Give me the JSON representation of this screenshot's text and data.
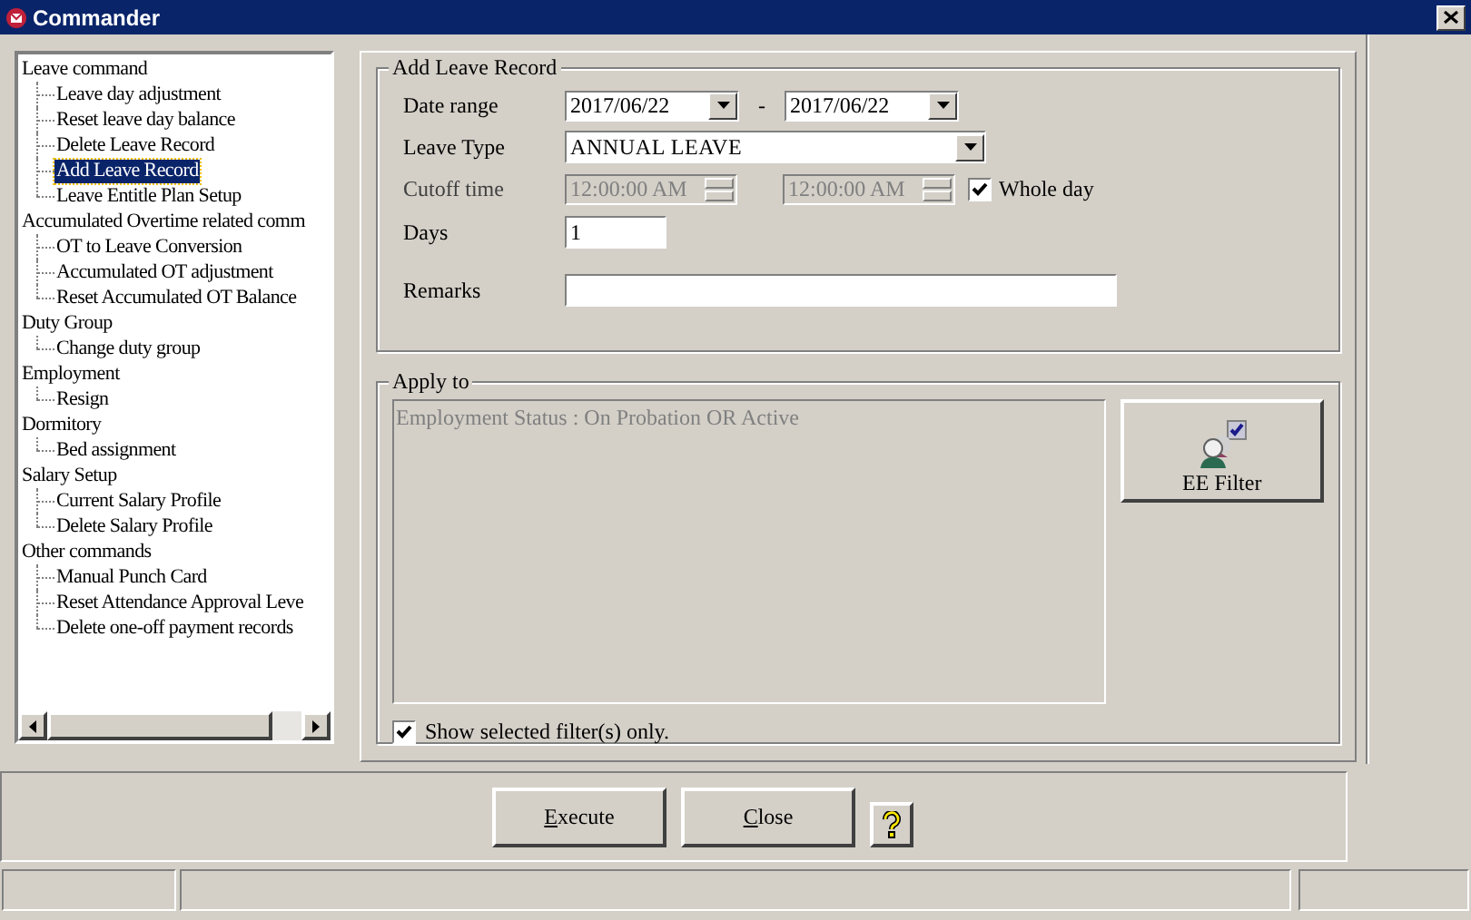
{
  "window": {
    "title": "Commander"
  },
  "tree": [
    {
      "label": "Leave command",
      "selected": false,
      "children": [
        {
          "label": "Leave day adjustment",
          "selected": false
        },
        {
          "label": "Reset leave day balance",
          "selected": false
        },
        {
          "label": "Delete Leave Record",
          "selected": false
        },
        {
          "label": "Add Leave Record",
          "selected": true
        },
        {
          "label": "Leave Entitle Plan Setup",
          "selected": false
        }
      ]
    },
    {
      "label": "Accumulated Overtime related comm",
      "selected": false,
      "children": [
        {
          "label": "OT to Leave Conversion",
          "selected": false
        },
        {
          "label": "Accumulated OT adjustment",
          "selected": false
        },
        {
          "label": "Reset Accumulated OT Balance",
          "selected": false
        }
      ]
    },
    {
      "label": "Duty Group",
      "selected": false,
      "children": [
        {
          "label": "Change duty group",
          "selected": false
        }
      ]
    },
    {
      "label": "Employment",
      "selected": false,
      "children": [
        {
          "label": "Resign",
          "selected": false
        }
      ]
    },
    {
      "label": "Dormitory",
      "selected": false,
      "children": [
        {
          "label": "Bed assignment",
          "selected": false
        }
      ]
    },
    {
      "label": "Salary Setup",
      "selected": false,
      "children": [
        {
          "label": "Current Salary Profile",
          "selected": false
        },
        {
          "label": "Delete Salary Profile",
          "selected": false
        }
      ]
    },
    {
      "label": "Other commands",
      "selected": false,
      "children": [
        {
          "label": "Manual Punch Card",
          "selected": false
        },
        {
          "label": "Reset Attendance Approval Leve",
          "selected": false
        },
        {
          "label": "Delete one-off payment records",
          "selected": false
        }
      ]
    }
  ],
  "leave_record": {
    "title": "Add Leave Record",
    "date_range": {
      "label": "Date range",
      "from": "2017/06/22",
      "separator": "-",
      "to": "2017/06/22"
    },
    "leave_type": {
      "label": "Leave Type",
      "value": "ANNUAL LEAVE"
    },
    "cutoff": {
      "label": "Cutoff time",
      "from": "12:00:00 AM",
      "to": "12:00:00 AM",
      "disabled": true
    },
    "whole_day": {
      "label": "Whole day",
      "checked": true
    },
    "days": {
      "label": "Days",
      "value": "1"
    },
    "remarks": {
      "label": "Remarks"
    }
  },
  "apply_to": {
    "title": "Apply to",
    "filter_text": "Employment Status : On Probation OR Active",
    "filter_button": "EE Filter",
    "show_selected": {
      "label": "Show selected filter(s) only.",
      "checked": true
    }
  },
  "buttons": [
    {
      "label": "Execute"
    },
    {
      "label": "Close"
    }
  ]
}
